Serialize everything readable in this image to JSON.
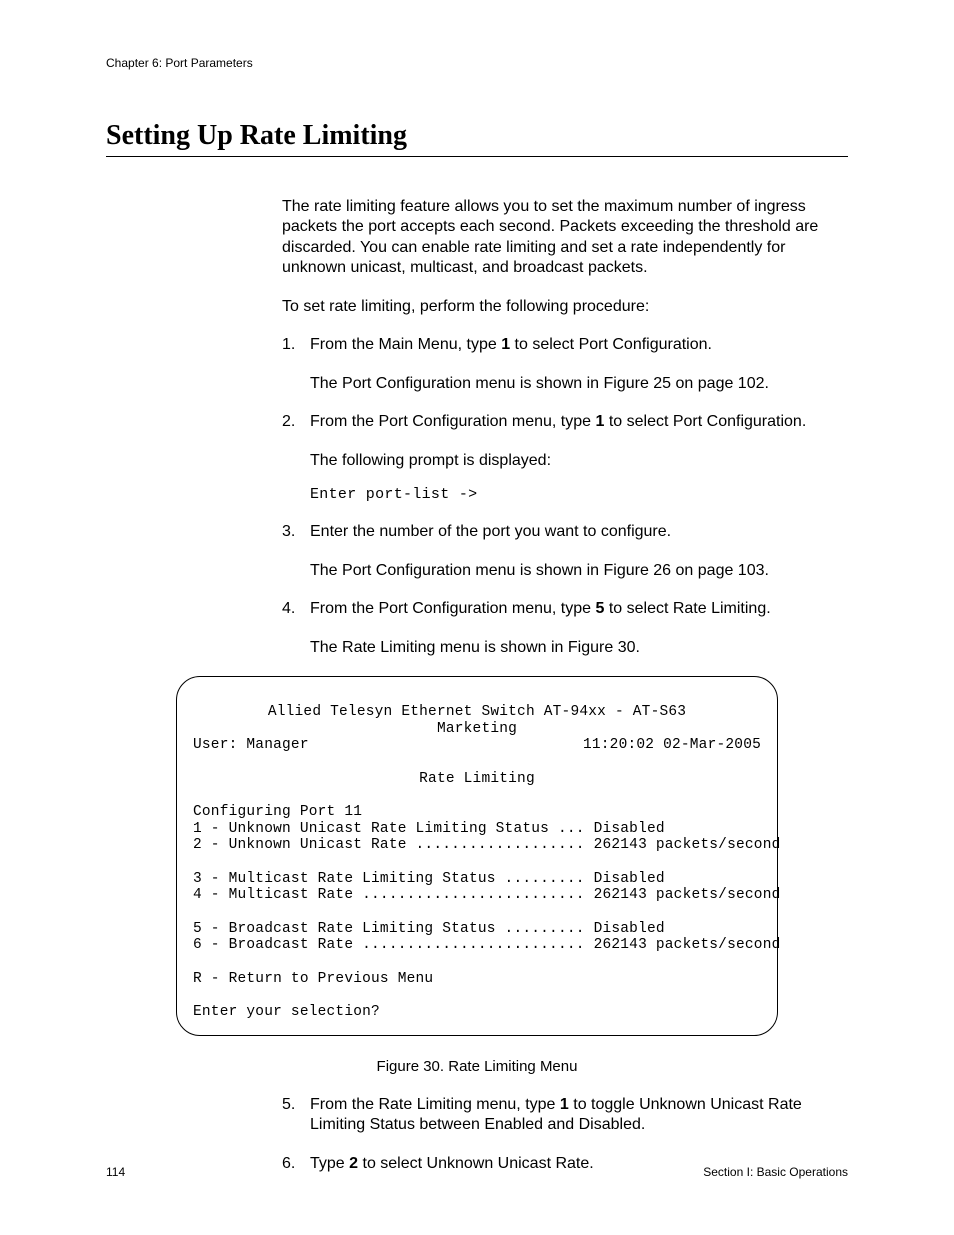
{
  "header": {
    "chapter": "Chapter 6: Port Parameters"
  },
  "title": "Setting Up Rate Limiting",
  "intro": "The rate limiting feature allows you to set the maximum number of ingress packets the port accepts each second. Packets exceeding the threshold are discarded. You can enable rate limiting and set a rate independently for unknown unicast, multicast, and broadcast packets.",
  "procedure_lead": "To set rate limiting, perform the following procedure:",
  "steps": {
    "s1": {
      "num": "1.",
      "text_a": "From the Main Menu, type ",
      "bold": "1",
      "text_b": " to select Port Configuration.",
      "sub": "The Port Configuration menu is shown in Figure 25 on page 102."
    },
    "s2": {
      "num": "2.",
      "text_a": "From the Port Configuration menu, type ",
      "bold": "1",
      "text_b": " to select Port Configuration.",
      "sub": "The following prompt is displayed:",
      "mono": "Enter port-list ->"
    },
    "s3": {
      "num": "3.",
      "text": "Enter the number of the port you want to configure.",
      "sub": "The Port Configuration menu is shown in Figure 26 on page 103."
    },
    "s4": {
      "num": "4.",
      "text_a": "From the Port Configuration menu, type ",
      "bold": "5",
      "text_b": " to select Rate Limiting.",
      "sub": "The Rate Limiting menu is shown in Figure 30."
    },
    "s5": {
      "num": "5.",
      "text_a": "From the Rate Limiting menu, type ",
      "bold": "1",
      "text_b": " to toggle Unknown Unicast Rate Limiting Status between Enabled and Disabled."
    },
    "s6": {
      "num": "6.",
      "text_a": "Type ",
      "bold": "2",
      "text_b": " to select Unknown Unicast Rate."
    }
  },
  "terminal": {
    "line1": "Allied Telesyn Ethernet Switch AT-94xx - AT-S63",
    "line2": "Marketing",
    "user": "User: Manager",
    "datetime": "11:20:02 02-Mar-2005",
    "title": "Rate Limiting",
    "config": "Configuring Port 11",
    "opt1": "1 - Unknown Unicast Rate Limiting Status ... Disabled",
    "opt2": "2 - Unknown Unicast Rate ................... 262143 packets/second",
    "opt3": "3 - Multicast Rate Limiting Status ......... Disabled",
    "opt4": "4 - Multicast Rate ......................... 262143 packets/second",
    "opt5": "5 - Broadcast Rate Limiting Status ......... Disabled",
    "opt6": "6 - Broadcast Rate ......................... 262143 packets/second",
    "ret": "R - Return to Previous Menu",
    "prompt": "Enter your selection?"
  },
  "figure_caption": "Figure 30. Rate Limiting Menu",
  "footer": {
    "page": "114",
    "section": "Section I: Basic Operations"
  }
}
